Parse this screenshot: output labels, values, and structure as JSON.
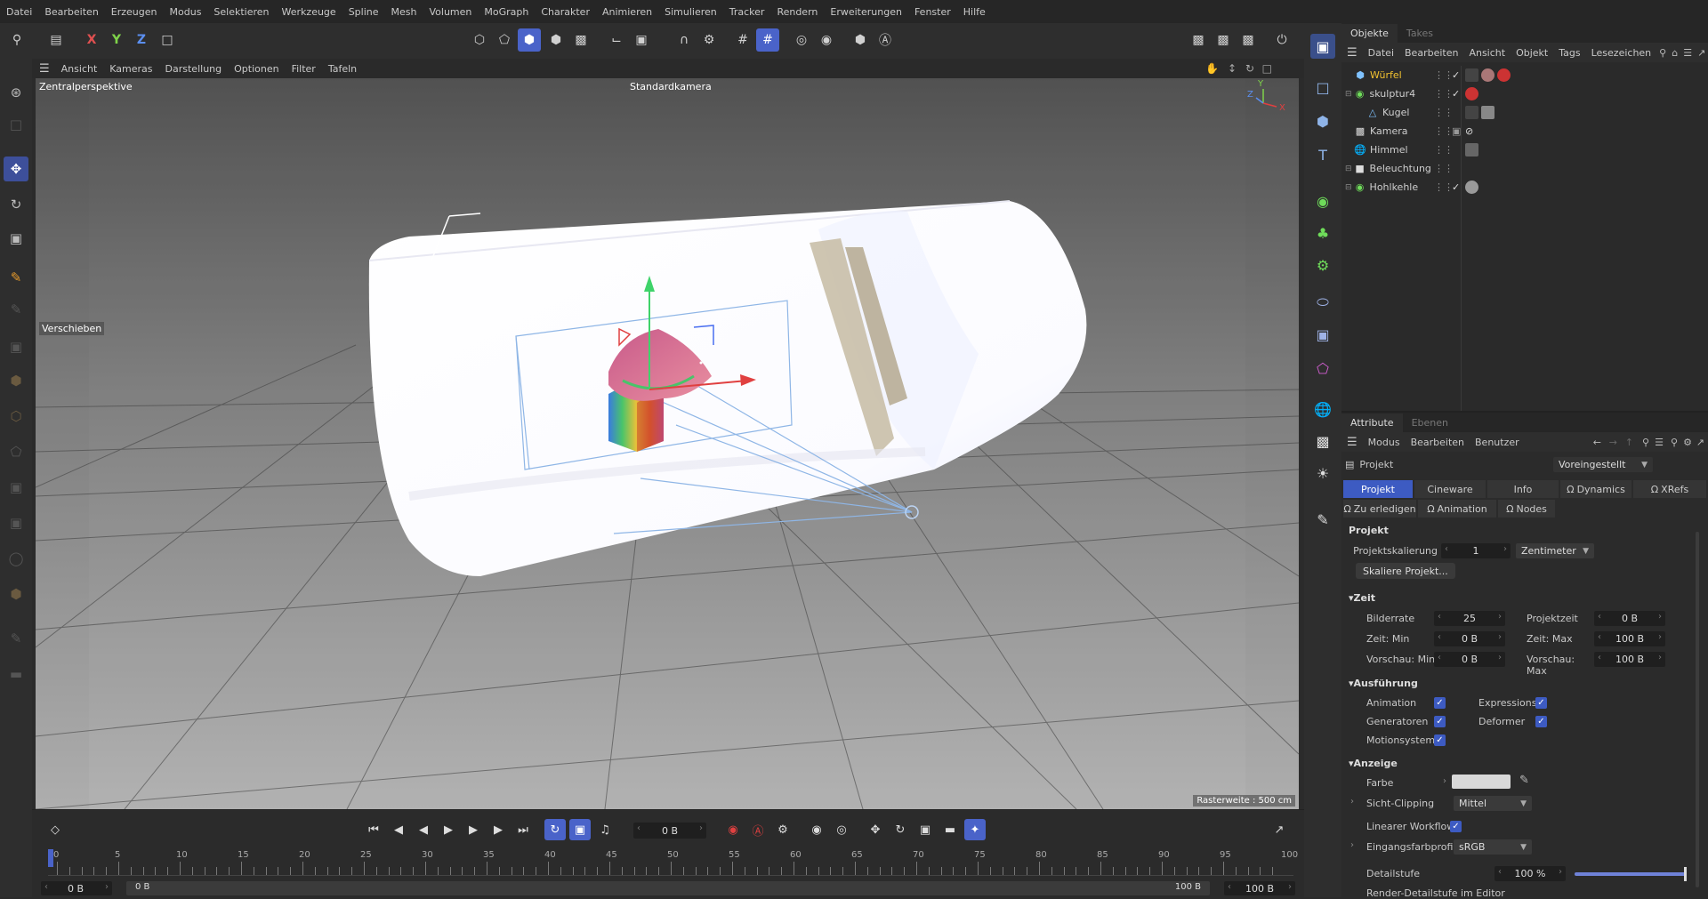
{
  "menubar": {
    "items": [
      "Datei",
      "Bearbeiten",
      "Erzeugen",
      "Modus",
      "Selektieren",
      "Werkzeuge",
      "Spline",
      "Mesh",
      "Volumen",
      "MoGraph",
      "Charakter",
      "Animieren",
      "Simulieren",
      "Tracker",
      "Rendern",
      "Erweiterungen",
      "Fenster",
      "Hilfe"
    ]
  },
  "toolbar": {
    "x_label": "X",
    "y_label": "Y",
    "z_label": "Z"
  },
  "viewport": {
    "menu": [
      "Ansicht",
      "Kameras",
      "Darstellung",
      "Optionen",
      "Filter",
      "Tafeln"
    ],
    "projection": "Zentralperspektive",
    "camera": "Standardkamera",
    "tool_hint": "Verschieben",
    "grid_info": "Rasterweite : 500 cm",
    "axis_labels": {
      "y": "Y",
      "z": "Z",
      "x": "X"
    }
  },
  "objects": {
    "tabs": [
      "Objekte",
      "Takes"
    ],
    "menu": [
      "Datei",
      "Bearbeiten",
      "Ansicht",
      "Objekt",
      "Tags",
      "Lesezeichen"
    ],
    "items": [
      {
        "name": "Würfel",
        "selected": true
      },
      {
        "name": "skulptur4"
      },
      {
        "name": "Kugel"
      },
      {
        "name": "Kamera"
      },
      {
        "name": "Himmel"
      },
      {
        "name": "Beleuchtung"
      },
      {
        "name": "Hohlkehle"
      }
    ]
  },
  "attributes": {
    "tabs": [
      "Attribute",
      "Ebenen"
    ],
    "menu": [
      "Modus",
      "Bearbeiten",
      "Benutzer"
    ],
    "object": "Projekt",
    "preset": "Voreingestellt",
    "ptabs_row1": [
      "Projekt",
      "Cineware",
      "Info",
      "Dynamics",
      "XRefs"
    ],
    "ptabs_row2": [
      "Zu erledigen",
      "Animation",
      "Nodes"
    ],
    "section_title": "Projekt",
    "scale_label": "Projektskalierung",
    "scale_value": "1",
    "scale_unit": "Zentimeter",
    "scale_button": "Skaliere Projekt...",
    "zeit": {
      "title": "Zeit",
      "bilderrate_label": "Bilderrate",
      "bilderrate": "25",
      "projektzeit_label": "Projektzeit",
      "projektzeit": "0 B",
      "zeitmin_label": "Zeit: Min",
      "zeitmin": "0 B",
      "zeitmax_label": "Zeit: Max",
      "zeitmax": "100 B",
      "vorschaumin_label": "Vorschau: Min",
      "vorschaumin": "0 B",
      "vorschaumax_label": "Vorschau: Max",
      "vorschaumax": "100 B"
    },
    "ausfuehrung": {
      "title": "Ausführung",
      "animation": "Animation",
      "expressions": "Expressions",
      "generatoren": "Generatoren",
      "deformer": "Deformer",
      "motionsystem": "Motionsystem"
    },
    "anzeige": {
      "title": "Anzeige",
      "farbe": "Farbe",
      "sicht_label": "Sicht-Clipping",
      "sicht_value": "Mittel",
      "linear": "Linearer Workflow",
      "farbprofil_label": "Eingangsfarbprofil",
      "farbprofil_value": "sRGB",
      "detail_label": "Detailstufe",
      "detail_value": "100 %",
      "detail_level": 1.0,
      "render_detail": "Render-Detailstufe im Editor"
    }
  },
  "timeline": {
    "current_frame": "0 B",
    "ticks": [
      "0",
      "5",
      "10",
      "15",
      "20",
      "25",
      "30",
      "35",
      "40",
      "45",
      "50",
      "55",
      "60",
      "65",
      "70",
      "75",
      "80",
      "85",
      "90",
      "95",
      "100"
    ],
    "range_start": "0 B",
    "range_start_inner": "0 B",
    "range_end_inner": "100 B",
    "range_end": "100 B"
  },
  "colors": {
    "accent": "#3d5bc2",
    "selected_object": "#f2c230"
  }
}
